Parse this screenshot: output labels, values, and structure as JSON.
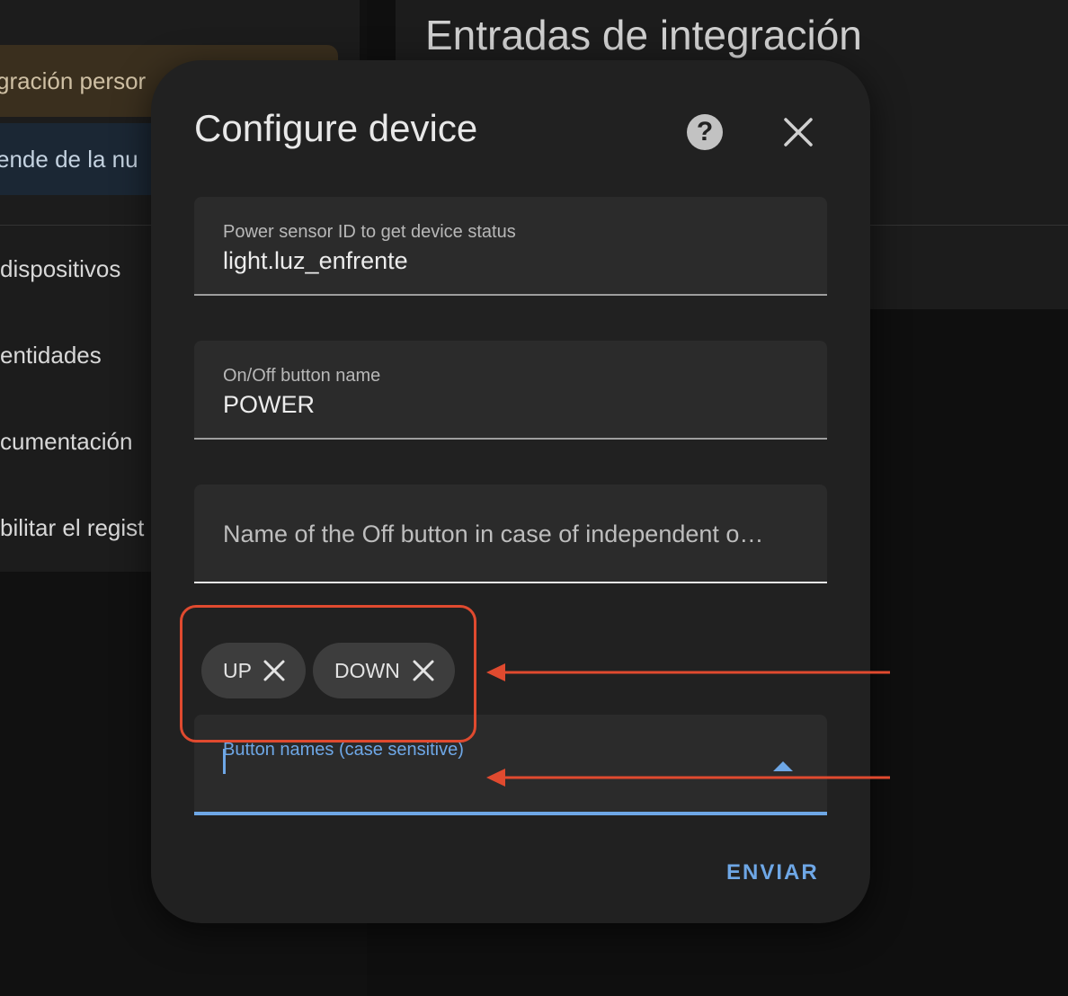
{
  "background": {
    "page_title": "Entradas de integración",
    "banners": {
      "custom_integration": "gración persor",
      "cloud_dependent": "ende de la nu"
    },
    "menu": [
      "dispositivos",
      "entidades",
      "cumentación",
      "bilitar el regist"
    ]
  },
  "dialog": {
    "title": "Configure device",
    "help_icon": "?",
    "fields": {
      "power_sensor": {
        "label": "Power sensor ID to get device status",
        "value": "light.luz_enfrente"
      },
      "on_off_button": {
        "label": "On/Off button name",
        "value": "POWER"
      },
      "off_button": {
        "placeholder": "Name of the Off button in case of independent o…"
      },
      "button_names": {
        "label": "Button names (case sensitive)",
        "chips": [
          "UP",
          "DOWN"
        ]
      }
    },
    "submit_label": "ENVIAR"
  },
  "colors": {
    "accent": "#6ea7e6",
    "annotation": "#e04a2f",
    "dialog_bg": "#212121",
    "field_bg": "#2b2b2b"
  }
}
